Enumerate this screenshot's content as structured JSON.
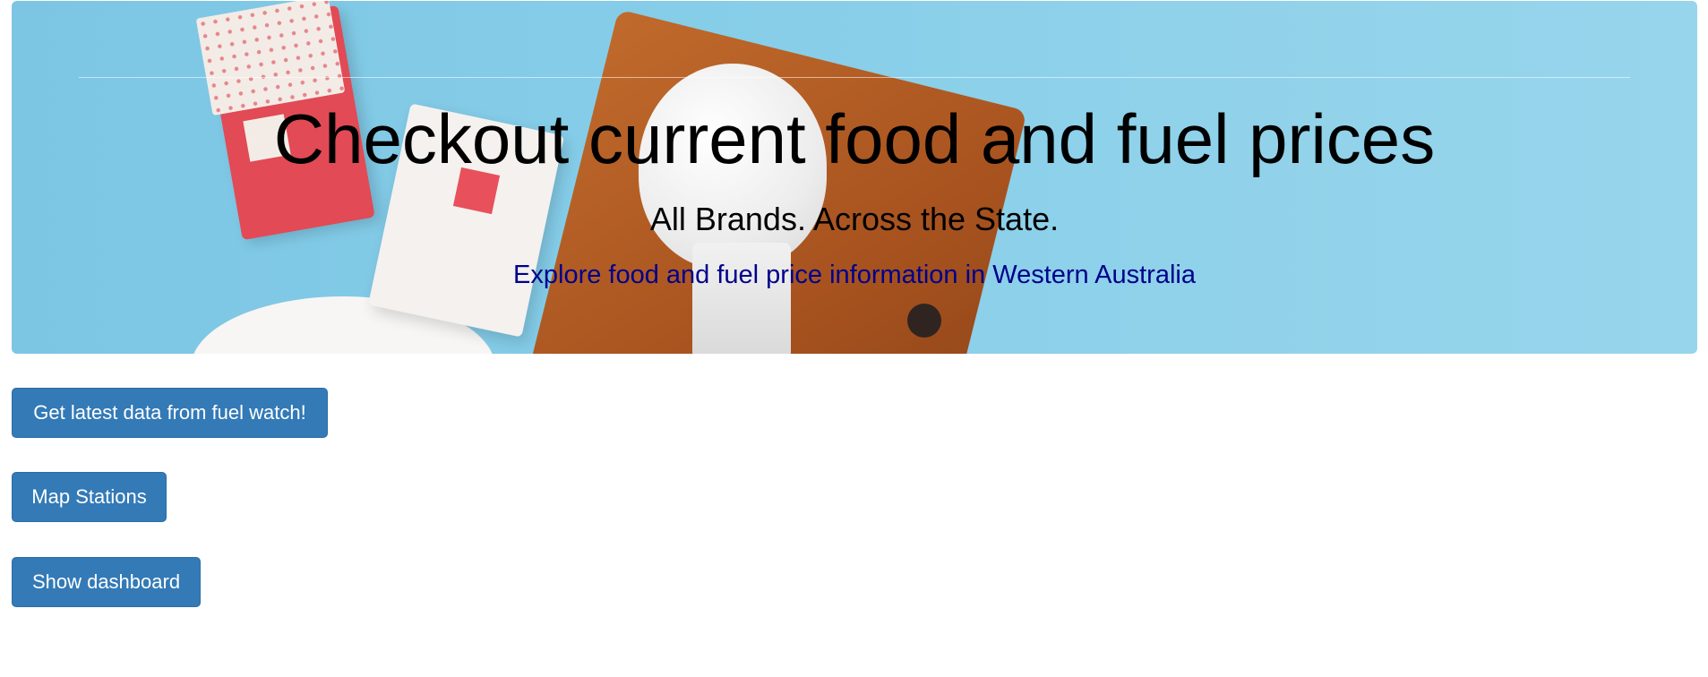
{
  "hero": {
    "title": "Checkout current food and fuel prices",
    "subtitle": "All Brands. Across the State.",
    "link_text": "Explore food and fuel price information in Western Australia",
    "link_color": "#00008b"
  },
  "actions": {
    "fuel_watch_label": "Get latest data from fuel watch!",
    "map_stations_label": "Map Stations",
    "dashboard_label": "Show dashboard",
    "button_color": "#337ab7"
  }
}
